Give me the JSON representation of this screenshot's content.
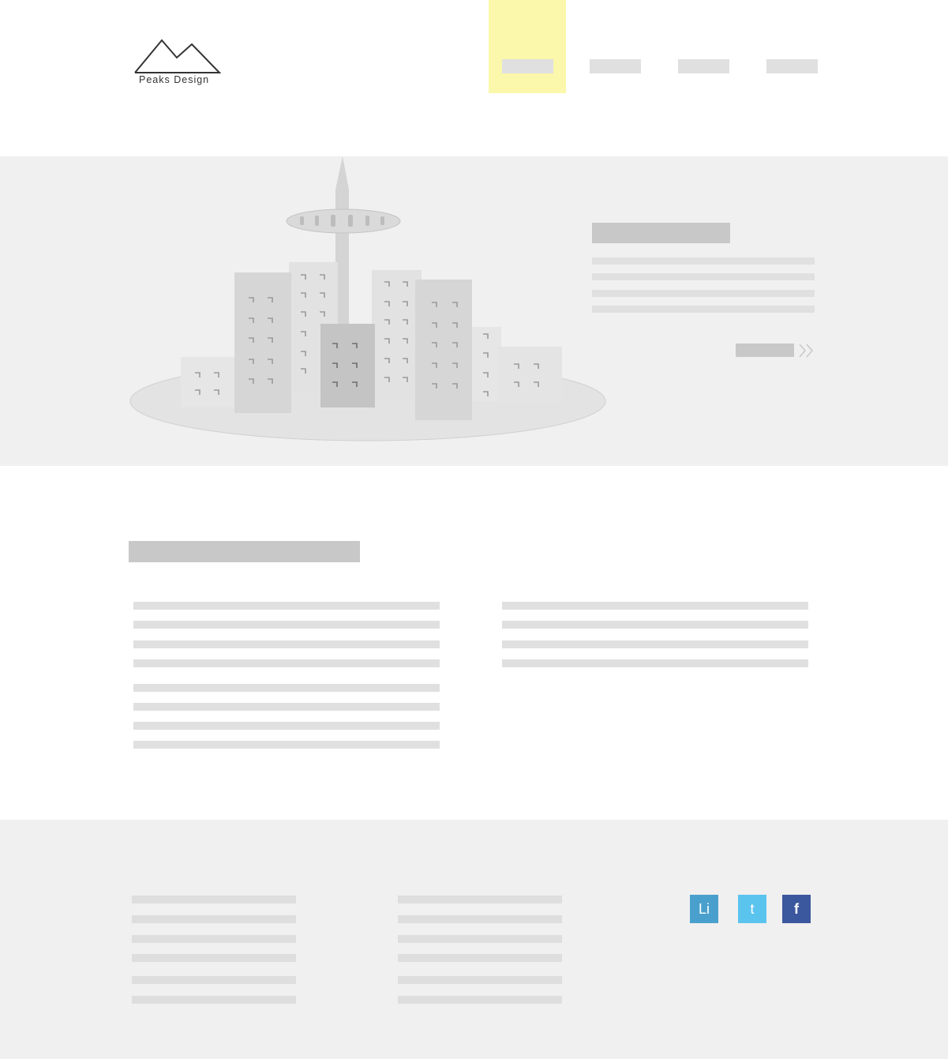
{
  "brand": {
    "logo_text": "Peaks Design"
  },
  "nav": {
    "items": [
      "",
      "",
      "",
      ""
    ],
    "active_index": 0,
    "highlight_color": "#fbf7ab"
  },
  "hero": {
    "illustration": "city-skyline-illustration",
    "cta_icon": "double-chevron-right-icon"
  },
  "social": {
    "linkedin": {
      "label": "Li",
      "color": "#4aa0cc"
    },
    "twitter": {
      "label": "t",
      "color": "#5bc4ee"
    },
    "facebook": {
      "label": "f",
      "color": "#3b579d"
    }
  },
  "colors": {
    "hero_background": "#f0f0f0",
    "footer_background": "#f0f0f0",
    "placeholder": "#e0e0e0",
    "placeholder_dark": "#c8c8c8"
  }
}
